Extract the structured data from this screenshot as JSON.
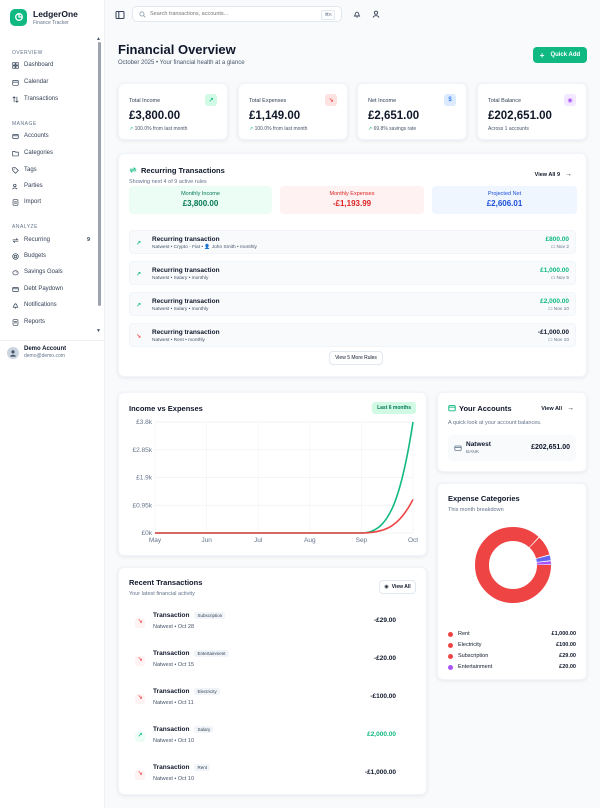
{
  "brand": {
    "name": "LedgerOne",
    "subtitle": "Finance Tracker"
  },
  "sidebar": {
    "sections": [
      "Overview",
      "Manage",
      "Analyze"
    ],
    "overview": [
      {
        "label": "Dashboard",
        "icon": "grid-icon"
      },
      {
        "label": "Calendar",
        "icon": "calendar-icon"
      },
      {
        "label": "Transactions",
        "icon": "arrows-icon"
      }
    ],
    "manage": [
      {
        "label": "Accounts",
        "icon": "bank-icon"
      },
      {
        "label": "Categories",
        "icon": "folder-icon"
      },
      {
        "label": "Tags",
        "icon": "tag-icon"
      },
      {
        "label": "Parties",
        "icon": "users-icon"
      },
      {
        "label": "Import",
        "icon": "import-icon"
      }
    ],
    "analyze": [
      {
        "label": "Recurring",
        "icon": "repeat-icon",
        "badge": "9"
      },
      {
        "label": "Budgets",
        "icon": "target-icon"
      },
      {
        "label": "Savings Goals",
        "icon": "piggy-icon"
      },
      {
        "label": "Debt Paydown",
        "icon": "card-icon"
      },
      {
        "label": "Notifications",
        "icon": "bell-icon"
      },
      {
        "label": "Reports",
        "icon": "report-icon"
      }
    ],
    "user": {
      "name": "Demo Account",
      "email": "demo@demo.com"
    }
  },
  "topbar": {
    "search_placeholder": "Search transactions, accounts...",
    "shortcut": "⌘K"
  },
  "page": {
    "title": "Financial Overview",
    "subtitle": "October 2025 • Your financial health at a glance",
    "quick_add": "Quick Add"
  },
  "stats": [
    {
      "label": "Total Income",
      "value": "£3,800.00",
      "note": "100.0% from last month",
      "icon": "trend-up-icon",
      "color": "#10b981",
      "bg": "#d1fae5",
      "glyph": "↗"
    },
    {
      "label": "Total Expenses",
      "value": "£1,149.00",
      "note": "100.0% from last month",
      "icon": "trend-down-icon",
      "color": "#ef4444",
      "bg": "#fee2e2",
      "glyph": "↘"
    },
    {
      "label": "Net Income",
      "value": "£2,651.00",
      "note": "69.8% savings rate",
      "icon": "dollar-icon",
      "color": "#3b82f6",
      "bg": "#dbeafe",
      "glyph": "$"
    },
    {
      "label": "Total Balance",
      "value": "£202,651.00",
      "note": "Across 1 accounts",
      "icon": "wallet-icon",
      "color": "#a855f7",
      "bg": "#f3e8ff",
      "glyph": "◉"
    }
  ],
  "recurring": {
    "title": "Recurring Transactions",
    "subtitle": "Showing next 4 of 9 active rules",
    "view_all": "View All 9",
    "summary": [
      {
        "label": "Monthly Income",
        "value": "£3,800.00",
        "bg": "#ecfdf5",
        "color": "#047857"
      },
      {
        "label": "Monthly Expenses",
        "value": "-£1,193.99",
        "bg": "#fef2f2",
        "color": "#dc2626"
      },
      {
        "label": "Projected Net",
        "value": "£2,606.01",
        "bg": "#eff6ff",
        "color": "#1d4ed8"
      }
    ],
    "rows": [
      {
        "title": "Recurring transaction",
        "meta": "Natwest • Crypto - Fiat • 👤 John Smith • monthly",
        "amount": "£800.00",
        "date": "Nov 2",
        "type": "in"
      },
      {
        "title": "Recurring transaction",
        "meta": "Natwest • Salary • monthly",
        "amount": "£1,000.00",
        "date": "Nov 5",
        "type": "in"
      },
      {
        "title": "Recurring transaction",
        "meta": "Natwest • Salary • monthly",
        "amount": "£2,000.00",
        "date": "Nov 10",
        "type": "in"
      },
      {
        "title": "Recurring transaction",
        "meta": "Natwest • Rent • monthly",
        "amount": "-£1,000.00",
        "date": "Nov 10",
        "type": "out"
      }
    ],
    "more": "View 5 More Rules"
  },
  "chart_data": {
    "type": "line",
    "title": "Income vs Expenses",
    "badge": "Last 6 months",
    "x": [
      "May",
      "Jun",
      "Jul",
      "Aug",
      "Sep",
      "Oct"
    ],
    "ylim": [
      0,
      3800
    ],
    "yticks": [
      "£3.8k",
      "£2.85k",
      "£1.9k",
      "£0.95k",
      "£0k"
    ],
    "grid": true,
    "series": [
      {
        "values": [
          0,
          0,
          0,
          0,
          0,
          3800
        ],
        "color": "#10b981"
      },
      {
        "values": [
          0,
          0,
          0,
          0,
          0,
          1149
        ],
        "color": "#ef4444"
      }
    ]
  },
  "accounts": {
    "title": "Your Accounts",
    "view_all": "View All",
    "subtitle": "A quick look at your account balances.",
    "items": [
      {
        "name": "Natwest",
        "type": "BANK",
        "balance": "£202,651.00"
      }
    ]
  },
  "recent": {
    "title": "Recent Transactions",
    "subtitle": "Your latest financial activity",
    "view_all": "View All",
    "rows": [
      {
        "title": "Transaction",
        "tag": "Subscription",
        "meta": "Natwest • Oct 28",
        "amount": "-£29.00",
        "type": "out"
      },
      {
        "title": "Transaction",
        "tag": "Entertainment",
        "meta": "Natwest • Oct 15",
        "amount": "-£20.00",
        "type": "out"
      },
      {
        "title": "Transaction",
        "tag": "Electricity",
        "meta": "Natwest • Oct 11",
        "amount": "-£100.00",
        "type": "out"
      },
      {
        "title": "Transaction",
        "tag": "Salary",
        "meta": "Natwest • Oct 10",
        "amount": "£2,000.00",
        "type": "in"
      },
      {
        "title": "Transaction",
        "tag": "Rent",
        "meta": "Natwest • Oct 10",
        "amount": "-£1,000.00",
        "type": "out"
      }
    ]
  },
  "expense_categories": {
    "title": "Expense Categories",
    "subtitle": "This month breakdown",
    "chart_data": {
      "type": "pie",
      "categories": [
        "Rent",
        "Electricity",
        "Subscription",
        "Entertainment"
      ],
      "values": [
        1000,
        100,
        29,
        20
      ],
      "labels": [
        "£1,000.00",
        "£100.00",
        "£29.00",
        "£20.00"
      ],
      "colors": [
        "#ef4444",
        "#ef4444",
        "#6366f1",
        "#a855f7"
      ]
    }
  },
  "colors": {
    "accent": "#10b981",
    "income": "#10b981",
    "expense": "#ef4444"
  }
}
